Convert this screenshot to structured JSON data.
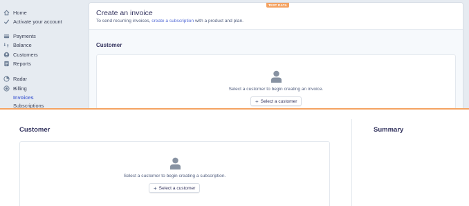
{
  "sidebar": {
    "items": [
      {
        "label": "Home",
        "icon": "home-icon"
      },
      {
        "label": "Activate your account",
        "icon": "check-icon"
      },
      {
        "label": "Payments",
        "icon": "payments-icon"
      },
      {
        "label": "Balance",
        "icon": "balance-icon"
      },
      {
        "label": "Customers",
        "icon": "customers-icon"
      },
      {
        "label": "Reports",
        "icon": "reports-icon"
      },
      {
        "label": "Radar",
        "icon": "radar-icon"
      },
      {
        "label": "Billing",
        "icon": "billing-icon"
      }
    ],
    "subitems": [
      {
        "label": "Invoices",
        "active": true
      },
      {
        "label": "Subscriptions",
        "active": false
      }
    ]
  },
  "test_badge": "TEST DATA",
  "invoice": {
    "title": "Create an invoice",
    "subtitle_before": "To send recurring invoices, ",
    "subtitle_link": "create a subscription",
    "subtitle_after": " with a product and plan.",
    "section_title": "Customer",
    "prompt": "Select a customer to begin creating an invoice.",
    "button_label": "Select a customer"
  },
  "subscription": {
    "section_title": "Customer",
    "prompt": "Select a customer to begin creating a subscription.",
    "button_label": "Select a customer",
    "summary_title": "Summary"
  },
  "colors": {
    "accent": "#556cd6",
    "test_badge": "#f4a261",
    "sidebar_bg": "#e6ebf1"
  }
}
